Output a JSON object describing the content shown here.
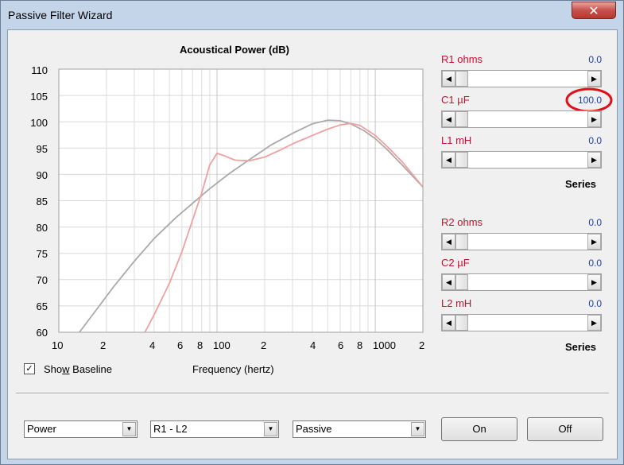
{
  "window": {
    "title": "Passive Filter Wizard",
    "close_glyph": "✕"
  },
  "chart": {
    "title": "Acoustical Power (dB)",
    "xlabel": "Frequency (hertz)",
    "y_ticks": [
      "110",
      "105",
      "100",
      "95",
      "90",
      "85",
      "80",
      "75",
      "70",
      "65",
      "60"
    ],
    "x_ticks": [
      "10",
      "2",
      "4",
      "6",
      "8",
      "100",
      "2",
      "4",
      "6",
      "8",
      "1000",
      "2"
    ]
  },
  "chart_data": {
    "type": "line",
    "title": "Acoustical Power (dB)",
    "xlabel": "Frequency (hertz)",
    "ylabel": "",
    "xscale": "log",
    "xlim": [
      10,
      2000
    ],
    "ylim": [
      60,
      110
    ],
    "grid": true,
    "series": [
      {
        "color": "#aaaaaa",
        "x": [
          13.5,
          17,
          22,
          30,
          40,
          55,
          70,
          90,
          120,
          160,
          220,
          300,
          400,
          500,
          600,
          700,
          850,
          1000,
          1200,
          1500,
          2000
        ],
        "y": [
          60,
          64,
          68.5,
          73.5,
          77.8,
          81.8,
          84.5,
          87.3,
          90.2,
          92.8,
          95.6,
          97.8,
          99.6,
          100.3,
          100.2,
          99.6,
          98.3,
          96.8,
          94.6,
          91.6,
          87.6
        ]
      },
      {
        "color": "#f0a0a0",
        "x": [
          35,
          40,
          50,
          60,
          70,
          80,
          90,
          100,
          110,
          130,
          160,
          200,
          250,
          300,
          400,
          500,
          600,
          700,
          800,
          1000,
          1200,
          1500,
          2000
        ],
        "y": [
          60,
          63.3,
          69.3,
          75.3,
          81.3,
          86.5,
          91.8,
          94,
          93.6,
          92.7,
          92.6,
          93.3,
          94.6,
          95.8,
          97.4,
          98.6,
          99.4,
          99.7,
          99.3,
          97.4,
          95.2,
          92.2,
          87.6
        ]
      }
    ]
  },
  "series1": {
    "r1": {
      "label": "R1  ohms",
      "value": "0.0"
    },
    "c1": {
      "label": "C1  µF",
      "value": "100.0"
    },
    "l1": {
      "label": "L1  mH",
      "value": "0.0"
    },
    "caption": "Series"
  },
  "series2": {
    "r2": {
      "label": "R2  ohms",
      "value": "0.0"
    },
    "c2": {
      "label": "C2  µF",
      "value": "0.0"
    },
    "l2": {
      "label": "L2  mH",
      "value": "0.0"
    },
    "caption": "Series"
  },
  "baseline": {
    "pre": "Sho",
    "ul": "w",
    "post": " Baseline",
    "checked_glyph": "✓"
  },
  "combos": {
    "mode": "Power",
    "pair": "R1 - L2",
    "type": "Passive",
    "arrow": "▼"
  },
  "buttons": {
    "on": "On",
    "off": "Off"
  },
  "scroll_glyphs": {
    "left": "◀",
    "right": "▶"
  },
  "annotation_color": "#e0101a"
}
